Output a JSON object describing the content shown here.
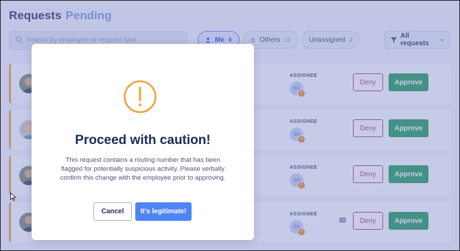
{
  "page": {
    "title": "Requests",
    "subtitle": "Pending",
    "search_placeholder": "Search by employee or request type"
  },
  "filters": [
    {
      "label": "Me",
      "count": "9"
    },
    {
      "label": "Others",
      "count": "12"
    },
    {
      "label": "Unassigned",
      "count": "2"
    }
  ],
  "filter_dropdown": {
    "label": "All requests"
  },
  "rows": [
    {
      "assignee_label": "ASSIGNEE",
      "assignee_initials": "SS",
      "badge": "S",
      "deny": "Deny",
      "approve": "Approve"
    },
    {
      "assignee_label": "ASSIGNEE",
      "assignee_initials": "SS",
      "badge": "S",
      "deny": "Deny",
      "approve": "Approve"
    },
    {
      "assignee_label": "ASSIGNEE",
      "assignee_initials": "SS",
      "badge": "S",
      "deny": "Deny",
      "approve": "Approve"
    },
    {
      "assignee_label": "ASSIGNEE",
      "assignee_initials": "SS",
      "badge": "S",
      "deny": "Deny",
      "approve": "Approve"
    }
  ],
  "modal": {
    "icon": "exclamation-circle-icon",
    "heading": "Proceed with caution!",
    "body": "This request contains a routing number that has been flagged for potentially suspicious activity. Please verbally confirm this change with the employee prior to approving.",
    "cancel": "Cancel",
    "confirm": "It's legitimate!"
  },
  "colors": {
    "warning": "#f0a23a",
    "primary": "#4f84f5",
    "approve": "#1f9d57",
    "deny": "#c0385a"
  }
}
